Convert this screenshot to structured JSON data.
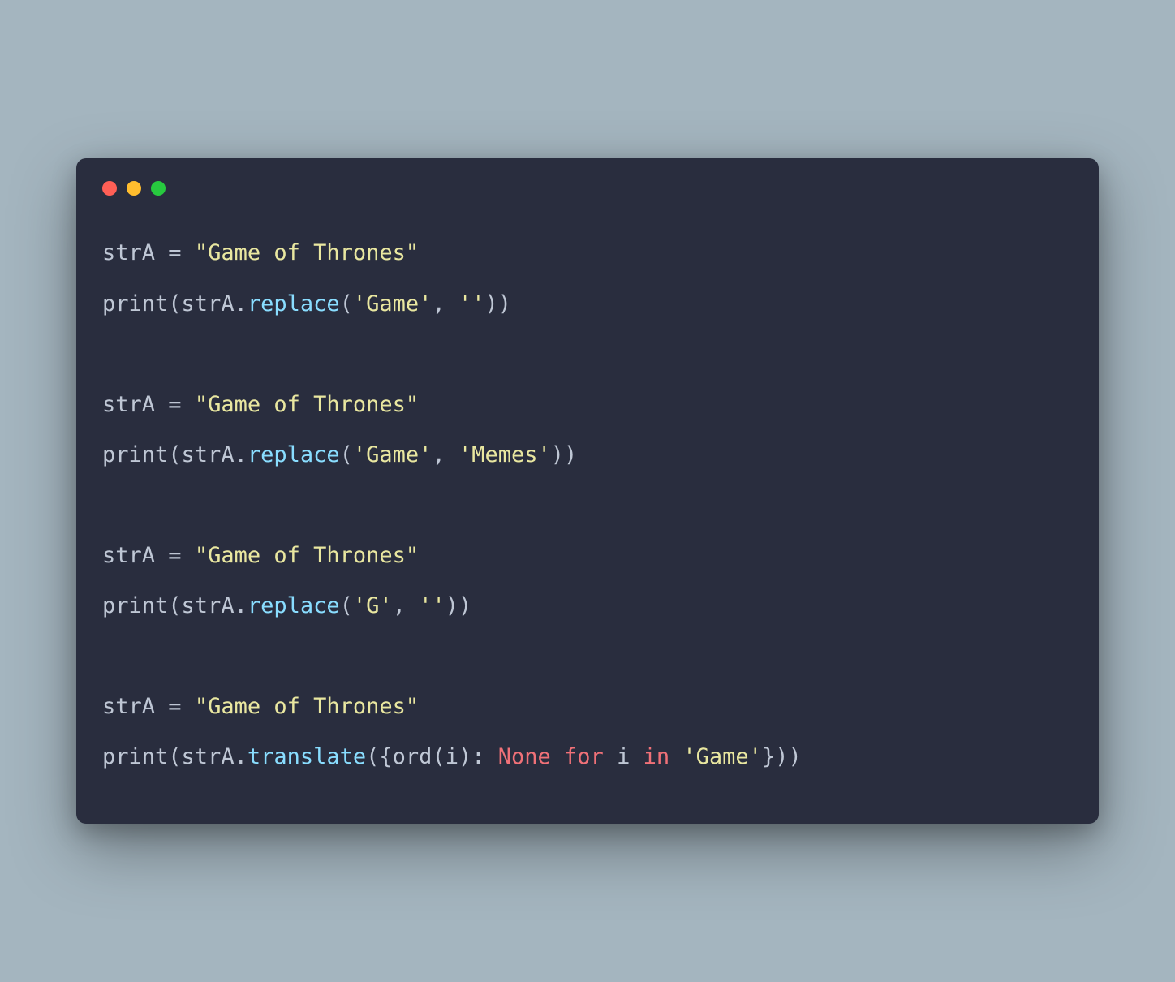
{
  "colors": {
    "background_page": "#a4b5bf",
    "background_window": "#292d3e",
    "dot_red": "#ff5f56",
    "dot_yellow": "#ffbd2e",
    "dot_green": "#27c93f",
    "text_default": "#bfc7d5",
    "text_string": "#e9e7a0",
    "text_method": "#89ddff",
    "text_keyword_pink": "#f07178"
  },
  "code": {
    "line1": {
      "var": "strA",
      "eq": " = ",
      "str": "\"Game of Thrones\""
    },
    "line2": {
      "fn": "print",
      "open": "(",
      "obj": "strA.",
      "method": "replace",
      "open2": "(",
      "arg1": "'Game'",
      "comma": ", ",
      "arg2": "''",
      "close": "))"
    },
    "line3": {
      "blank": ""
    },
    "line4": {
      "var": "strA",
      "eq": " = ",
      "str": "\"Game of Thrones\""
    },
    "line5": {
      "fn": "print",
      "open": "(",
      "obj": "strA.",
      "method": "replace",
      "open2": "(",
      "arg1": "'Game'",
      "comma": ", ",
      "arg2": "'Memes'",
      "close": "))"
    },
    "line6": {
      "blank": ""
    },
    "line7": {
      "var": "strA",
      "eq": " = ",
      "str": "\"Game of Thrones\""
    },
    "line8": {
      "fn": "print",
      "open": "(",
      "obj": "strA.",
      "method": "replace",
      "open2": "(",
      "arg1": "'G'",
      "comma": ", ",
      "arg2": "''",
      "close": "))"
    },
    "line9": {
      "blank": ""
    },
    "line10": {
      "var": "strA",
      "eq": " = ",
      "str": "\"Game of Thrones\""
    },
    "line11": {
      "fn": "print",
      "open": "(",
      "obj": "strA.",
      "method": "translate",
      "open2": "({",
      "ord": "ord",
      "open3": "(",
      "ivar": "i",
      "close3": "): ",
      "none": "None",
      "sp1": " ",
      "for": "for",
      "sp2": " ",
      "ivar2": "i",
      "sp3": " ",
      "in": "in",
      "sp4": " ",
      "arg": "'Game'",
      "close": "}))"
    }
  }
}
